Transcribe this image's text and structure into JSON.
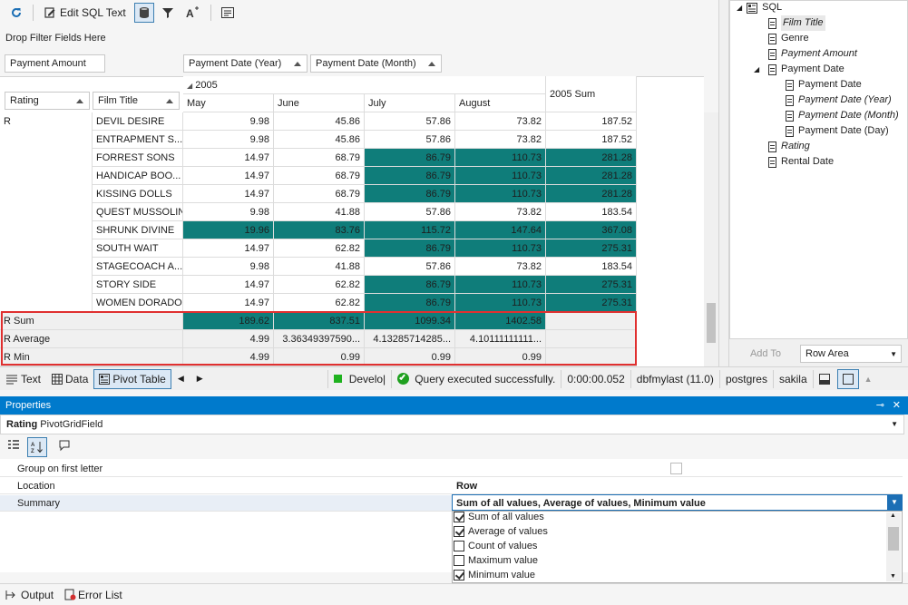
{
  "toolbar": {
    "edit_sql_label": "Edit SQL Text"
  },
  "filter_area": {
    "hint": "Drop Filter Fields Here"
  },
  "data_fields": [
    "Payment Amount"
  ],
  "column_fields": [
    "Payment Date (Year)",
    "Payment Date (Month)"
  ],
  "row_fields": [
    "Rating",
    "Film Title"
  ],
  "pivot": {
    "year": "2005",
    "months": [
      "May",
      "June",
      "July",
      "August"
    ],
    "year_sum_label": "2005 Sum",
    "rating": "R",
    "rows": [
      {
        "film": "DEVIL DESIRE",
        "values": [
          "9.98",
          "45.86",
          "57.86",
          "73.82",
          "187.52"
        ]
      },
      {
        "film": "ENTRAPMENT S...",
        "values": [
          "9.98",
          "45.86",
          "57.86",
          "73.82",
          "187.52"
        ]
      },
      {
        "film": "FORREST SONS",
        "values": [
          "14.97",
          "68.79",
          "86.79",
          "110.73",
          "281.28"
        ]
      },
      {
        "film": "HANDICAP BOO...",
        "values": [
          "14.97",
          "68.79",
          "86.79",
          "110.73",
          "281.28"
        ]
      },
      {
        "film": "KISSING DOLLS",
        "values": [
          "14.97",
          "68.79",
          "86.79",
          "110.73",
          "281.28"
        ]
      },
      {
        "film": "QUEST MUSSOLINI",
        "values": [
          "9.98",
          "41.88",
          "57.86",
          "73.82",
          "183.54"
        ]
      },
      {
        "film": "SHRUNK DIVINE",
        "values": [
          "19.96",
          "83.76",
          "115.72",
          "147.64",
          "367.08"
        ]
      },
      {
        "film": "SOUTH WAIT",
        "values": [
          "14.97",
          "62.82",
          "86.79",
          "110.73",
          "275.31"
        ]
      },
      {
        "film": "STAGECOACH A...",
        "values": [
          "9.98",
          "41.88",
          "57.86",
          "73.82",
          "183.54"
        ]
      },
      {
        "film": "STORY SIDE",
        "values": [
          "14.97",
          "62.82",
          "86.79",
          "110.73",
          "275.31"
        ]
      },
      {
        "film": "WOMEN DORADO",
        "values": [
          "14.97",
          "62.82",
          "86.79",
          "110.73",
          "275.31"
        ]
      }
    ],
    "totals": [
      {
        "label": "R Sum",
        "values": [
          "189.62",
          "837.51",
          "1099.34",
          "1402.58",
          ""
        ]
      },
      {
        "label": "R Average",
        "values": [
          "4.99",
          "3.36349397590...",
          "4.13285714285...",
          "4.10111111111...",
          ""
        ]
      },
      {
        "label": "R Min",
        "values": [
          "4.99",
          "0.99",
          "0.99",
          "0.99",
          ""
        ]
      }
    ]
  },
  "field_list": {
    "root": "SQL",
    "items": [
      {
        "label": "Film Title",
        "indent": 0,
        "italic": true,
        "selected": true
      },
      {
        "label": "Genre",
        "indent": 0,
        "italic": false
      },
      {
        "label": "Payment Amount",
        "indent": 0,
        "italic": true
      },
      {
        "label": "Payment Date",
        "indent": 0,
        "italic": false,
        "expandable": true
      },
      {
        "label": "Payment Date",
        "indent": 1,
        "italic": false
      },
      {
        "label": "Payment Date (Year)",
        "indent": 1,
        "italic": true
      },
      {
        "label": "Payment Date (Month)",
        "indent": 1,
        "italic": true
      },
      {
        "label": "Payment Date (Day)",
        "indent": 1,
        "italic": false
      },
      {
        "label": "Rating",
        "indent": 0,
        "italic": true
      },
      {
        "label": "Rental Date",
        "indent": 0,
        "italic": false
      }
    ],
    "add_to_label": "Add To",
    "area_select": "Row Area"
  },
  "status_bar": {
    "tabs": [
      "Text",
      "Data",
      "Pivot Table"
    ],
    "conn_label": "Develo|",
    "message": "Query executed successfully.",
    "time": "0:00:00.052",
    "server": "dbfmylast (11.0)",
    "user": "postgres",
    "database": "sakila"
  },
  "properties": {
    "title": "Properties",
    "field_name": "Rating",
    "field_type": "PivotGridField",
    "rows": [
      {
        "name": "Group on first letter",
        "value": ""
      },
      {
        "name": "Location",
        "value": "Row"
      },
      {
        "name": "Summary",
        "value": "Sum of all values, Average of values, Minimum value"
      }
    ],
    "options": [
      {
        "label": "Sum of all values",
        "checked": true
      },
      {
        "label": "Average of values",
        "checked": true
      },
      {
        "label": "Count of values",
        "checked": false
      },
      {
        "label": "Maximum value",
        "checked": false
      },
      {
        "label": "Minimum value",
        "checked": true
      }
    ]
  },
  "bottom_tabs": [
    "Output",
    "Error List"
  ],
  "colors": {
    "highlight": "#0f7d7a",
    "accent": "#007acc",
    "selection_border": "#e03030"
  }
}
